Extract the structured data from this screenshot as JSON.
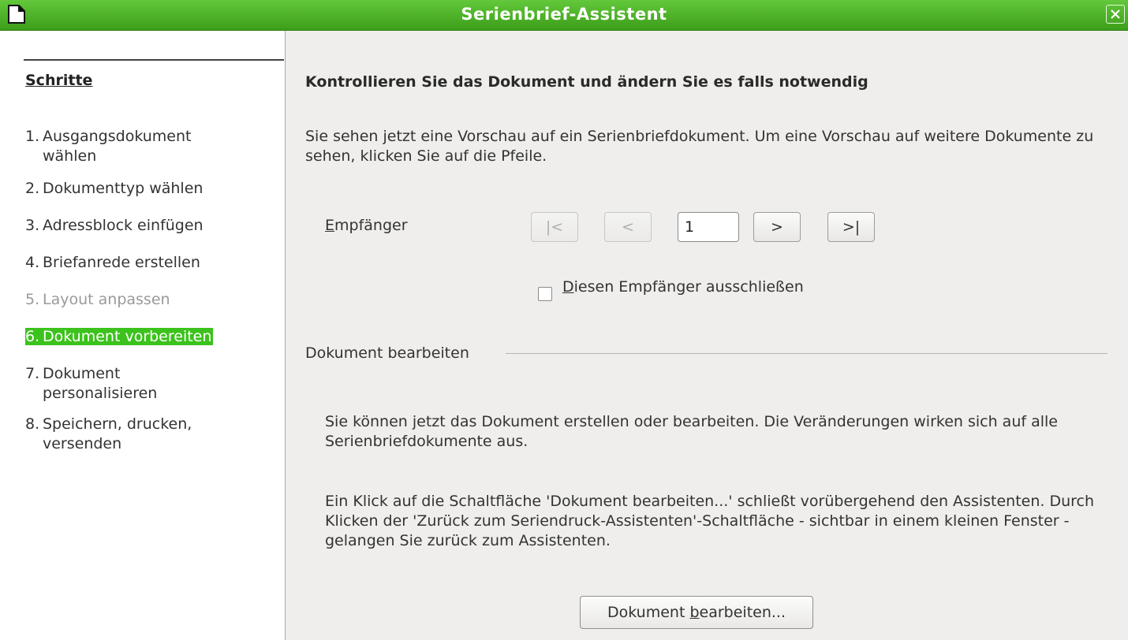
{
  "window": {
    "title": "Serienbrief-Assistent",
    "app_icon": "document-icon",
    "close_icon": "close-icon",
    "accent_color": "#4cb229"
  },
  "sidebar": {
    "heading": "Schritte",
    "steps": [
      {
        "num": "1.",
        "label": "Ausgangsdokument",
        "label2": "wählen",
        "state": "normal"
      },
      {
        "num": "2.",
        "label": "Dokumenttyp wählen",
        "state": "normal"
      },
      {
        "num": "3.",
        "label": "Adressblock einfügen",
        "state": "normal"
      },
      {
        "num": "4.",
        "label": "Briefanrede erstellen",
        "state": "normal"
      },
      {
        "num": "5.",
        "label": "Layout anpassen",
        "state": "disabled"
      },
      {
        "num": "6.",
        "label": "Dokument vorbereiten",
        "state": "active"
      },
      {
        "num": "7.",
        "label": "Dokument",
        "label2": "personalisieren",
        "state": "normal"
      },
      {
        "num": "8.",
        "label": "Speichern, drucken,",
        "label2": "versenden",
        "state": "normal"
      }
    ]
  },
  "main": {
    "heading": "Kontrollieren Sie das Dokument und ändern Sie es falls notwendig",
    "intro": "Sie sehen jetzt eine Vorschau auf ein Serienbriefdokument. Um eine Vorschau auf weitere Dokumente zu sehen, klicken Sie auf die Pfeile.",
    "recipient_label_first": "E",
    "recipient_label_rest": "mpfänger",
    "nav": {
      "first": "|<",
      "prev": "<",
      "current": "1",
      "next": ">",
      "last": ">|"
    },
    "exclude_checkbox": {
      "checked": false,
      "label_first": "D",
      "label_rest": "iesen Empfänger ausschließen"
    },
    "edit_section": {
      "title": "Dokument bearbeiten",
      "para1": "Sie können jetzt das Dokument erstellen oder bearbeiten. Die Veränderungen wirken sich auf alle Serienbriefdokumente aus.",
      "para2": "Ein Klick auf die Schaltfläche 'Dokument bearbeiten...' schließt vorübergehend den Assistenten. Durch Klicken der 'Zurück zum Seriendruck-Assistenten'-Schaltfläche - sichtbar in einem kleinen Fenster - gelangen Sie zurück zum Assistenten.",
      "button_pre": "Dokument ",
      "button_mnemonic": "b",
      "button_post": "earbeiten..."
    }
  }
}
